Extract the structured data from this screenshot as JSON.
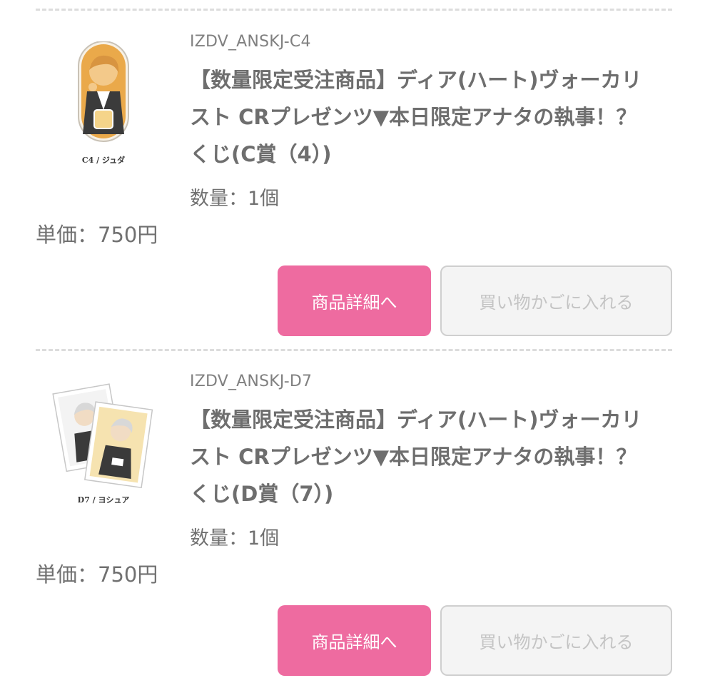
{
  "items": [
    {
      "code": "IZDV_ANSKJ-C4",
      "name": "【数量限定受注商品】ディア(ハート)ヴォーカリスト CRプレゼンツ▼本日限定アナタの執事！？ くじ(C賞（4）)",
      "thumb_label": "C4 / ジュダ",
      "thumb_image": "acrylic-stand-orange-character",
      "quantity_text": "数量：1個",
      "price_text": "単価：750円",
      "detail_button": "商品詳細へ",
      "cart_button": "買い物かごに入れる"
    },
    {
      "code": "IZDV_ANSKJ-D7",
      "name": "【数量限定受注商品】ディア(ハート)ヴォーカリスト CRプレゼンツ▼本日限定アナタの執事！？ くじ(D賞（7）)",
      "thumb_label": "D7 / ヨシュア",
      "thumb_image": "card-set-character",
      "quantity_text": "数量：1個",
      "price_text": "単価：750円",
      "detail_button": "商品詳細へ",
      "cart_button": "買い物かごに入れる"
    }
  ],
  "colors": {
    "accent": "#ee6ba0",
    "divider": "#dcdcdc",
    "disabled_bg": "#f4f4f4",
    "disabled_text": "#c4c4c4"
  }
}
